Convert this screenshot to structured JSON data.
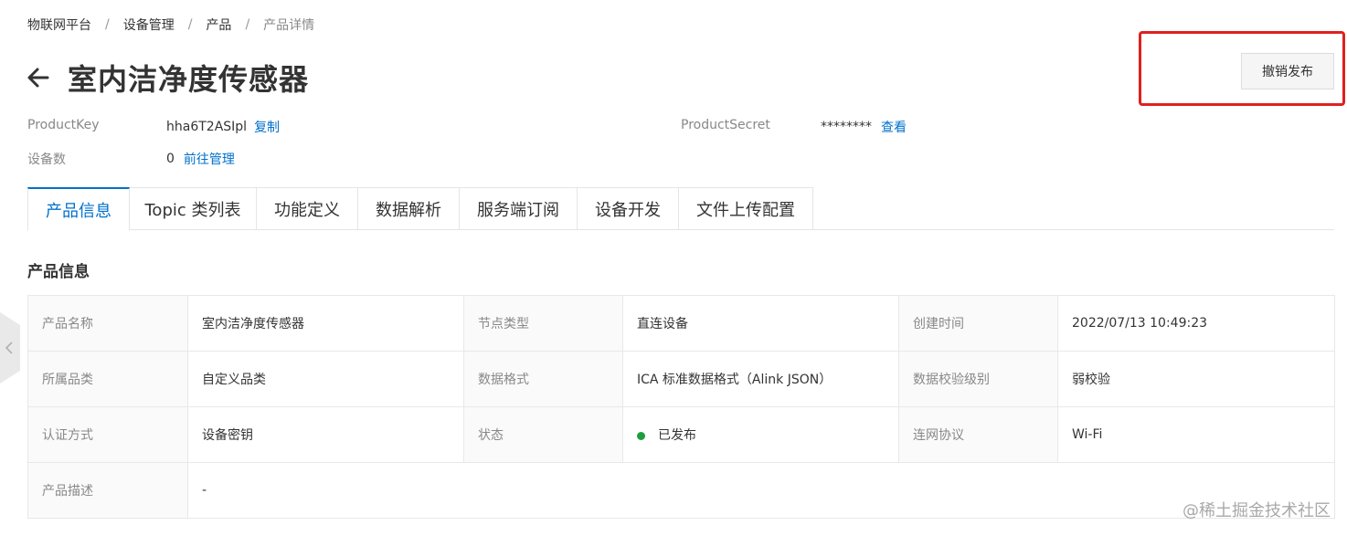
{
  "breadcrumb": {
    "items": [
      "物联网平台",
      "设备管理",
      "产品",
      "产品详情"
    ],
    "separator": "/"
  },
  "header": {
    "back_icon": "arrow-left-icon",
    "title": "室内洁净度传感器",
    "revoke_button": "撤销发布"
  },
  "meta": {
    "product_key_label": "ProductKey",
    "product_key_value": "hha6T2ASIpl",
    "copy_link": "复制",
    "product_secret_label": "ProductSecret",
    "product_secret_value": "********",
    "view_link": "查看",
    "device_count_label": "设备数",
    "device_count_value": "0",
    "manage_link": "前往管理"
  },
  "tabs": [
    {
      "label": "产品信息",
      "active": true
    },
    {
      "label": "Topic 类列表",
      "active": false
    },
    {
      "label": "功能定义",
      "active": false
    },
    {
      "label": "数据解析",
      "active": false
    },
    {
      "label": "服务端订阅",
      "active": false
    },
    {
      "label": "设备开发",
      "active": false
    },
    {
      "label": "文件上传配置",
      "active": false
    }
  ],
  "section": {
    "title": "产品信息"
  },
  "info": {
    "rows": [
      [
        {
          "label": "产品名称",
          "value": "室内洁净度传感器"
        },
        {
          "label": "节点类型",
          "value": "直连设备"
        },
        {
          "label": "创建时间",
          "value": "2022/07/13 10:49:23"
        }
      ],
      [
        {
          "label": "所属品类",
          "value": "自定义品类"
        },
        {
          "label": "数据格式",
          "value": "ICA 标准数据格式（Alink JSON）"
        },
        {
          "label": "数据校验级别",
          "value": "弱校验"
        }
      ],
      [
        {
          "label": "认证方式",
          "value": "设备密钥"
        },
        {
          "label": "状态",
          "value": "已发布"
        },
        {
          "label": "连网协议",
          "value": "Wi-Fi"
        }
      ]
    ],
    "description_label": "产品描述",
    "description_value": "-"
  },
  "colors": {
    "accent": "#0070cc",
    "status_published": "#1e9e3e",
    "highlight": "#e02020"
  },
  "side_handle_icon": "chevron-left-icon",
  "watermark": "@稀土掘金技术社区"
}
